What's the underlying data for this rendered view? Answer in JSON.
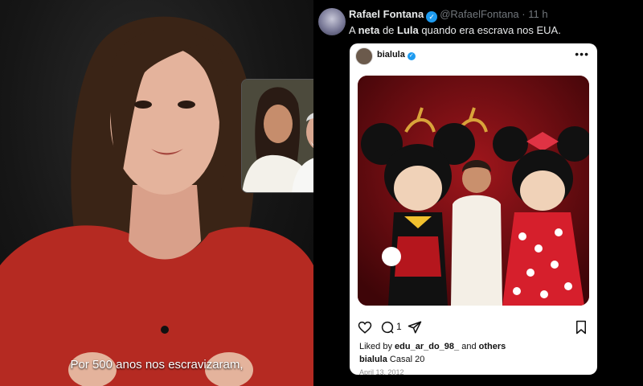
{
  "video": {
    "caption": "Por 500 anos nos escravizaram,"
  },
  "tweet": {
    "name": "Rafael Fontana",
    "handle": "@RafaelFontana",
    "time": "11 h",
    "text_prefix": "A",
    "text_bold_1": "neta",
    "text_mid": "de",
    "text_bold_2": "Lula",
    "text_suffix": "quando era escrava nos EUA."
  },
  "instagram": {
    "username": "bialula",
    "more_icon": "more-dots-icon",
    "comment_count": "1",
    "liked_by_prefix": "Liked by",
    "liked_by_user": "edu_ar_do_98_",
    "liked_by_and": "and",
    "liked_by_others": "others",
    "caption_user": "bialula",
    "caption_text": "Casal 20",
    "date": "April 13, 2012"
  },
  "colors": {
    "verified_blue": "#1d9bf0",
    "background": "#000000",
    "card_background": "#ffffff",
    "photo_red": "#8a1016"
  }
}
